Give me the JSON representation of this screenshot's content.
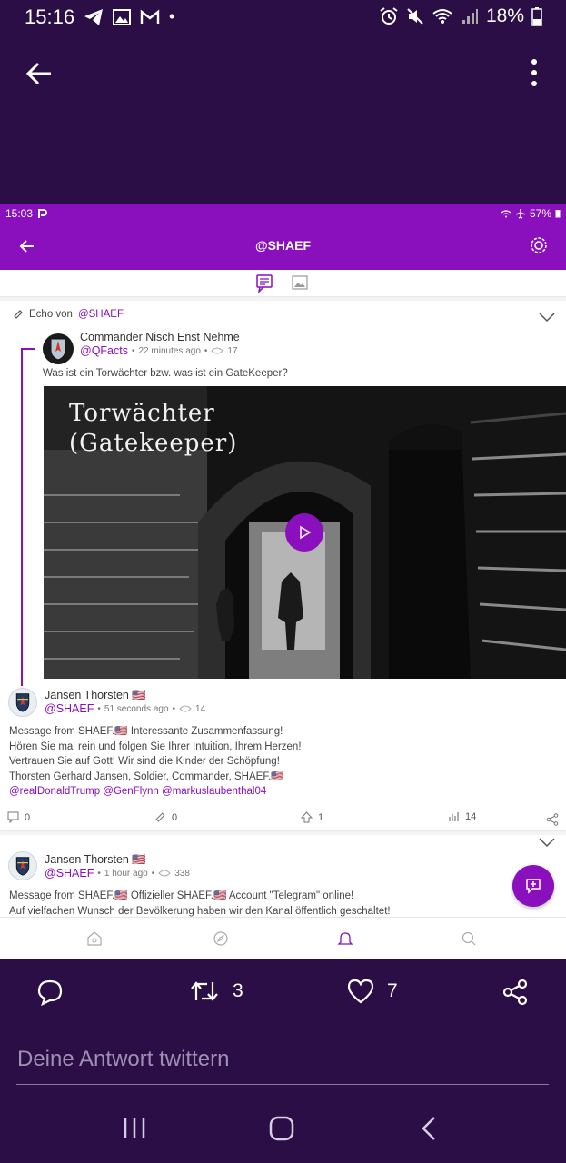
{
  "outer_status": {
    "time": "15:16",
    "battery": "18%"
  },
  "inner_status": {
    "time": "15:03",
    "battery": "57%"
  },
  "inner_appbar": {
    "title": "@SHAEF"
  },
  "post1": {
    "echo_prefix": "Echo von",
    "echo_handle": "@SHAEF",
    "quoted": {
      "name": "Commander Nisch Enst Nehme",
      "handle": "@QFacts",
      "time": "22 minutes ago",
      "views": "17",
      "text": "Was ist ein Torwächter bzw. was ist ein GateKeeper?",
      "video_title_line1": "Torwächter",
      "video_title_line2": "(Gatekeeper)"
    },
    "author": {
      "name": "Jansen Thorsten 🇺🇸",
      "handle": "@SHAEF",
      "time": "51 seconds ago",
      "views": "14"
    },
    "lines": [
      "Message from SHAEF.🇺🇸 Interessante Zusammenfassung!",
      "Hören Sie mal rein und folgen Sie Ihrer Intuition, Ihrem Herzen!",
      "Vertrauen Sie auf Gott! Wir sind die Kinder der Schöpfung!",
      "Thorsten Gerhard Jansen, Soldier, Commander, SHAEF.🇺🇸"
    ],
    "mentions": "@realDonaldTrump @GenFlynn @markuslaubenthal04",
    "stats": {
      "comments": "0",
      "echoes": "0",
      "upvotes": "1",
      "views": "14"
    }
  },
  "post2": {
    "name": "Jansen Thorsten 🇺🇸",
    "handle": "@SHAEF",
    "time": "1 hour ago",
    "views": "338",
    "line1": "Message from SHAEF.🇺🇸 Offizieller SHAEF.🇺🇸 Account \"Telegram\" online!",
    "line2": "Auf vielfachen Wunsch der Bevölkerung haben wir den Kanal öffentlich geschaltet!"
  },
  "outer_actions": {
    "retweets": "3",
    "likes": "7"
  },
  "reply": {
    "placeholder": "Deine Antwort twittern"
  },
  "colors": {
    "accent": "#8a0fbd",
    "outer_bg": "#2a0e45"
  }
}
